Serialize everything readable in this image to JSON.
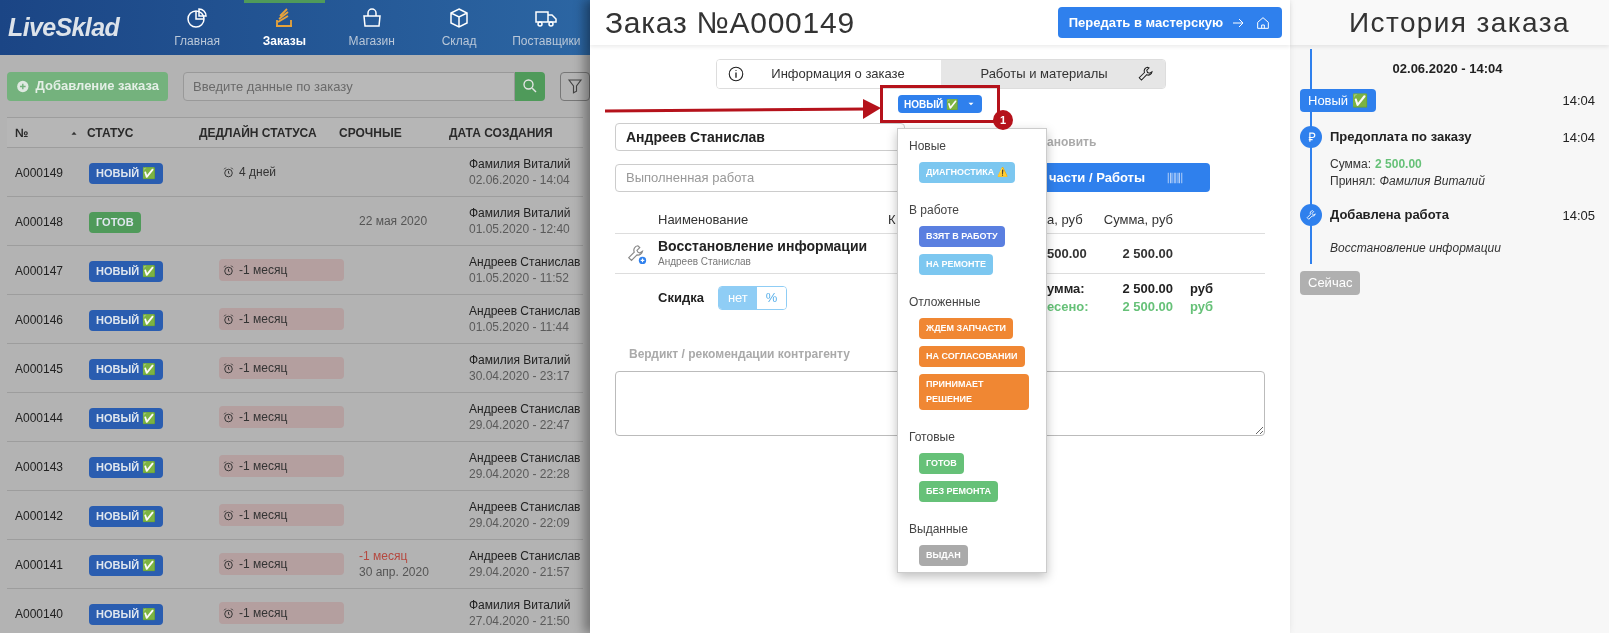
{
  "app": {
    "logo": "LiveSklad",
    "nav": [
      {
        "label": "Главная",
        "selected": false
      },
      {
        "label": "Заказы",
        "selected": true
      },
      {
        "label": "Магазин",
        "selected": false
      },
      {
        "label": "Склад",
        "selected": false
      },
      {
        "label": "Поставщики",
        "selected": false
      }
    ]
  },
  "toolbar": {
    "add_button": "Добавление заказа",
    "search": {
      "placeholder": "Введите данные по заказу"
    }
  },
  "orders_table": {
    "columns": [
      "№",
      "СТАТУС",
      "ДЕДЛАЙН СТАТУСА",
      "СРОЧНЫЕ",
      "ДАТА СОЗДАНИЯ"
    ],
    "rows": [
      {
        "number": "A000149",
        "status": {
          "label": "НОВЫЙ ✅",
          "color": "#2a5db0"
        },
        "deadline": {
          "text": "4 дней",
          "overdue": false
        },
        "created_by": "Фамилия Виталий",
        "created_at": "02.06.2020 - 14:04"
      },
      {
        "number": "A000148",
        "status": {
          "label": "ГОТОВ",
          "color": "#4f9a5a"
        },
        "urgent_date": "22 мая 2020",
        "created_by": "Фамилия Виталий",
        "created_at": "01.05.2020 - 12:40"
      },
      {
        "number": "A000147",
        "status": {
          "label": "НОВЫЙ ✅",
          "color": "#2a5db0"
        },
        "deadline": {
          "text": "-1 месяц",
          "overdue": true
        },
        "created_by": "Андреев Станислав",
        "created_at": "01.05.2020 - 11:52"
      },
      {
        "number": "A000146",
        "status": {
          "label": "НОВЫЙ ✅",
          "color": "#2a5db0"
        },
        "deadline": {
          "text": "-1 месяц",
          "overdue": true
        },
        "created_by": "Андреев Станислав",
        "created_at": "01.05.2020 - 11:44"
      },
      {
        "number": "A000145",
        "status": {
          "label": "НОВЫЙ ✅",
          "color": "#2a5db0"
        },
        "deadline": {
          "text": "-1 месяц",
          "overdue": true
        },
        "created_by": "Фамилия Виталий",
        "created_at": "30.04.2020 - 23:17"
      },
      {
        "number": "A000144",
        "status": {
          "label": "НОВЫЙ ✅",
          "color": "#2a5db0"
        },
        "deadline": {
          "text": "-1 месяц",
          "overdue": true
        },
        "created_by": "Андреев Станислав",
        "created_at": "29.04.2020 - 22:47"
      },
      {
        "number": "A000143",
        "status": {
          "label": "НОВЫЙ ✅",
          "color": "#2a5db0"
        },
        "deadline": {
          "text": "-1 месяц",
          "overdue": true
        },
        "created_by": "Андреев Станислав",
        "created_at": "29.04.2020 - 22:28"
      },
      {
        "number": "A000142",
        "status": {
          "label": "НОВЫЙ ✅",
          "color": "#2a5db0"
        },
        "deadline": {
          "text": "-1 месяц",
          "overdue": true
        },
        "created_by": "Андреев Станислав",
        "created_at": "29.04.2020 - 22:09"
      },
      {
        "number": "A000141",
        "status": {
          "label": "НОВЫЙ ✅",
          "color": "#2a5db0"
        },
        "deadline": {
          "text": "-1 месяц",
          "overdue": true
        },
        "urgent_warning": "-1 месяц",
        "urgent_date": "30 апр. 2020",
        "created_by": "Андреев Станислав",
        "created_at": "29.04.2020 - 21:57"
      },
      {
        "number": "A000140",
        "status": {
          "label": "НОВЫЙ ✅",
          "color": "#2a5db0"
        },
        "deadline": {
          "text": "-1 месяц",
          "overdue": true
        },
        "created_by": "Фамилия Виталий",
        "created_at": "27.04.2020 - 21:50"
      }
    ]
  },
  "order": {
    "title": "Заказ №A000149",
    "transfer_button": "Передать в мастерскую",
    "tabs": [
      {
        "label": "Информация о заказе",
        "selected": true
      },
      {
        "label": "Работы и материалы",
        "selected": false
      }
    ],
    "status_button": {
      "label": "НОВЫЙ ✅",
      "color": "#2f80ed"
    },
    "annotation": {
      "badge": "1"
    },
    "client_field": {
      "value": "Андреев Станислав"
    },
    "work_field": {
      "placeholder": "Выполненная работа"
    },
    "install_label": "ановить",
    "parts_button": "части / Работы",
    "items_table": {
      "columns": [
        "Наименование",
        "К",
        "а, руб",
        "Сумма, руб"
      ],
      "rows": [
        {
          "name": "Восстановление информации",
          "performer": "Андреев Станислав",
          "price": "500.00",
          "sum": "2 500.00"
        }
      ]
    },
    "discount": {
      "label": "Скидка",
      "options": [
        {
          "label": "нет",
          "selected": true
        },
        {
          "label": "%",
          "selected": false
        }
      ]
    },
    "totals": [
      {
        "label": "умма:",
        "value": "2 500.00",
        "currency": "руб",
        "kind": "total"
      },
      {
        "label": "есено:",
        "value": "2 500.00",
        "currency": "руб",
        "kind": "paid"
      }
    ],
    "verdict": {
      "label": "Вердикт / рекомендации контрагенту"
    }
  },
  "status_menu": {
    "groups": [
      {
        "title": "Новые",
        "items": [
          {
            "label": "ДИАГНОСТИКА ⚠️",
            "color": "#7cc7f0"
          }
        ]
      },
      {
        "title": "В работе",
        "items": [
          {
            "label": "ВЗЯТ В РАБОТУ",
            "color": "#5a7fe0"
          },
          {
            "label": "НА РЕМОНТЕ",
            "color": "#7cc7f0"
          }
        ]
      },
      {
        "title": "Отложенные",
        "items": [
          {
            "label": "ЖДЕМ ЗАПЧАСТИ",
            "color": "#f08733"
          },
          {
            "label": "НА СОГЛАСОВАНИИ",
            "color": "#f08733"
          },
          {
            "label": "ПРИНИМАЕТ РЕШЕНИЕ",
            "color": "#f08733"
          }
        ]
      },
      {
        "title": "Готовые",
        "items": [
          {
            "label": "ГОТОВ",
            "color": "#66c178"
          },
          {
            "label": "БЕЗ РЕМОНТА",
            "color": "#66c178"
          }
        ]
      },
      {
        "title": "Выданные",
        "items": [
          {
            "label": "ВЫДАН",
            "color": "#aaaaaa"
          }
        ]
      }
    ]
  },
  "history": {
    "title": "История заказа",
    "date": "02.06.2020 - 14:04",
    "events": [
      {
        "kind": "status",
        "label": "Новый ✅",
        "time": "14:04"
      },
      {
        "kind": "payment",
        "title": "Предоплата по заказу",
        "time": "14:04",
        "details": [
          {
            "label": "Сумма:",
            "value": "2 500.00",
            "kind": "amount"
          },
          {
            "label": "Принял:",
            "value": "Фамилия Виталий",
            "kind": "person"
          }
        ]
      },
      {
        "kind": "work",
        "title": "Добавлена работа",
        "time": "14:05",
        "note": "Восстановление информации"
      }
    ],
    "now_button": "Сейчас"
  }
}
